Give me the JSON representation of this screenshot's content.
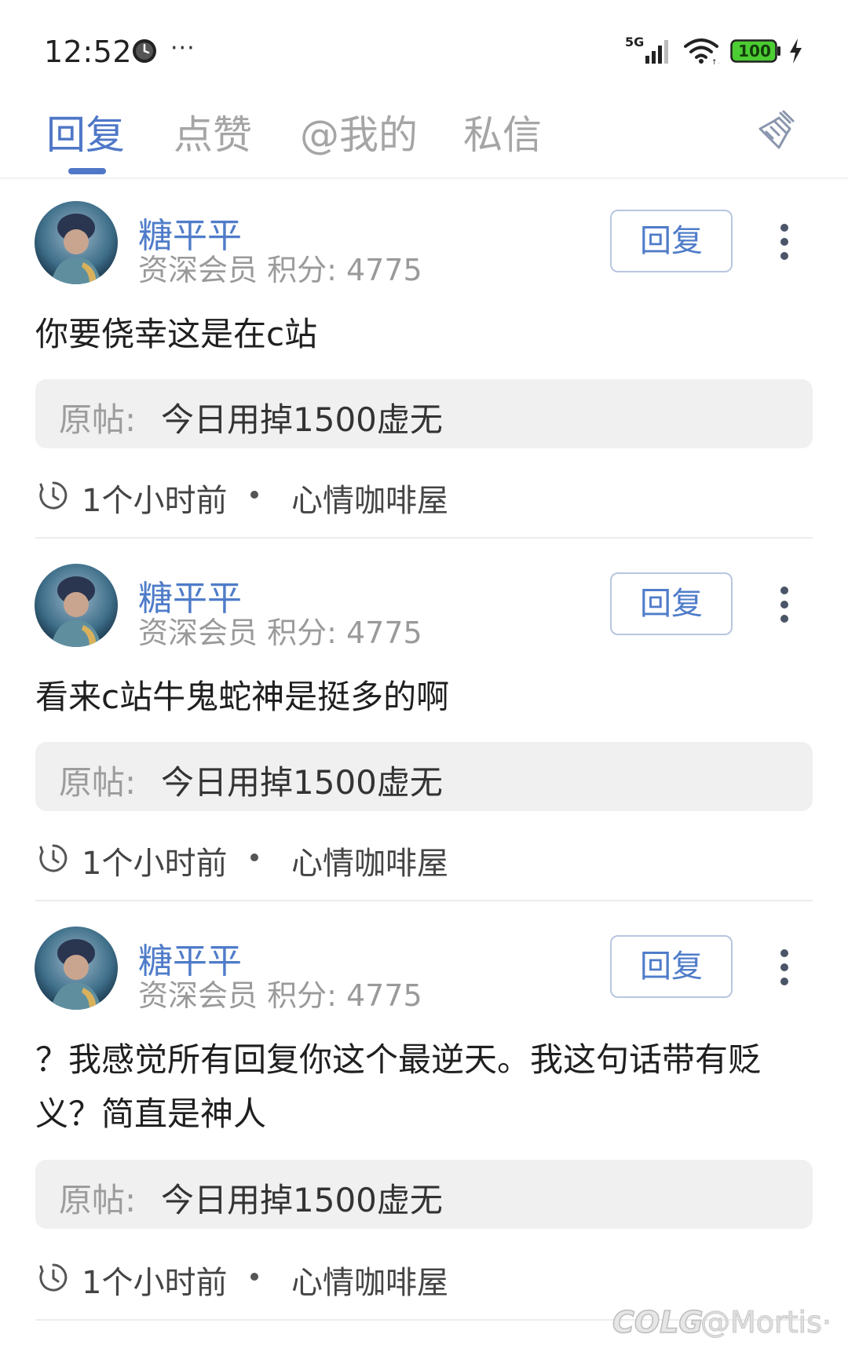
{
  "status_bar": {
    "time": "12:52",
    "more": "···",
    "network": "5G",
    "battery": "100",
    "icons": [
      "clock-icon",
      "signal-icon",
      "wifi-icon",
      "battery-icon",
      "charging-bolt-icon"
    ]
  },
  "tabs": [
    {
      "label": "回复",
      "active": true
    },
    {
      "label": "点赞",
      "active": false
    },
    {
      "label": "@我的",
      "active": false
    },
    {
      "label": "私信",
      "active": false
    }
  ],
  "clear_icon": "broom-icon",
  "colors": {
    "accent": "#4f77c7",
    "muted": "#a5a5a5",
    "origin_bg": "#f0f0f0"
  },
  "reply_button_label": "回复",
  "origin_label": "原帖:",
  "posts": [
    {
      "username": "糖平平",
      "member_info": "资深会员 积分: 4775",
      "content": "你要侥幸这是在c站",
      "origin_title": "今日用掉1500虚无",
      "time": "1个小时前",
      "forum": "心情咖啡屋"
    },
    {
      "username": "糖平平",
      "member_info": "资深会员 积分: 4775",
      "content": "看来c站牛鬼蛇神是挺多的啊",
      "origin_title": "今日用掉1500虚无",
      "time": "1个小时前",
      "forum": "心情咖啡屋"
    },
    {
      "username": "糖平平",
      "member_info": "资深会员 积分: 4775",
      "content": "？我感觉所有回复你这个最逆天。我这句话带有贬义？简直是神人",
      "origin_title": "今日用掉1500虚无",
      "time": "1个小时前",
      "forum": "心情咖啡屋"
    }
  ],
  "watermark": {
    "logo": "COLG",
    "handle": "@Mortis·"
  }
}
